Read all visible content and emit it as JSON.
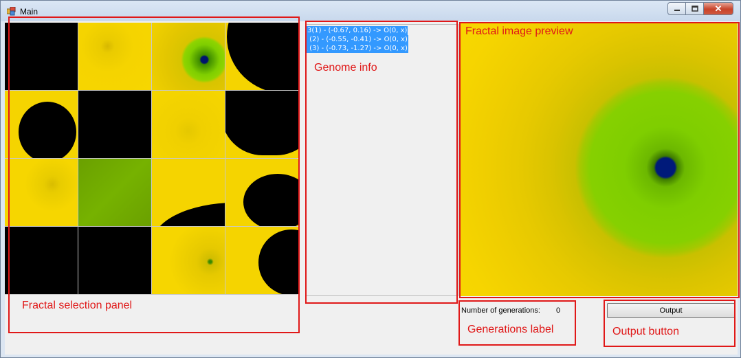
{
  "window": {
    "title": "Main",
    "icon": "app-icon"
  },
  "title_controls": {
    "minimize": "minimize-icon",
    "maximize": "maximize-icon",
    "close_label": "✕"
  },
  "genome": {
    "lines": [
      "3(1) - (-0.67, 0.16) -> O(0, x)",
      " (2) - (-0.55, -0.41) -> O(0, x)",
      " (3) - (-0.73, -1.27) -> O(0, x)"
    ]
  },
  "generations": {
    "label": "Number of generations:",
    "value": "0"
  },
  "output_button": {
    "label": "Output"
  },
  "annotations": {
    "selection": "Fractal selection panel",
    "genome": "Genome info",
    "preview": "Fractal image preview",
    "generations": "Generations label",
    "output": "Output button"
  },
  "colors": {
    "fractal_yellow": "#f5d400",
    "fractal_green": "#7fce00",
    "fractal_black": "#000000",
    "fractal_blue": "#001b7a",
    "annotation_red": "#e01818"
  }
}
